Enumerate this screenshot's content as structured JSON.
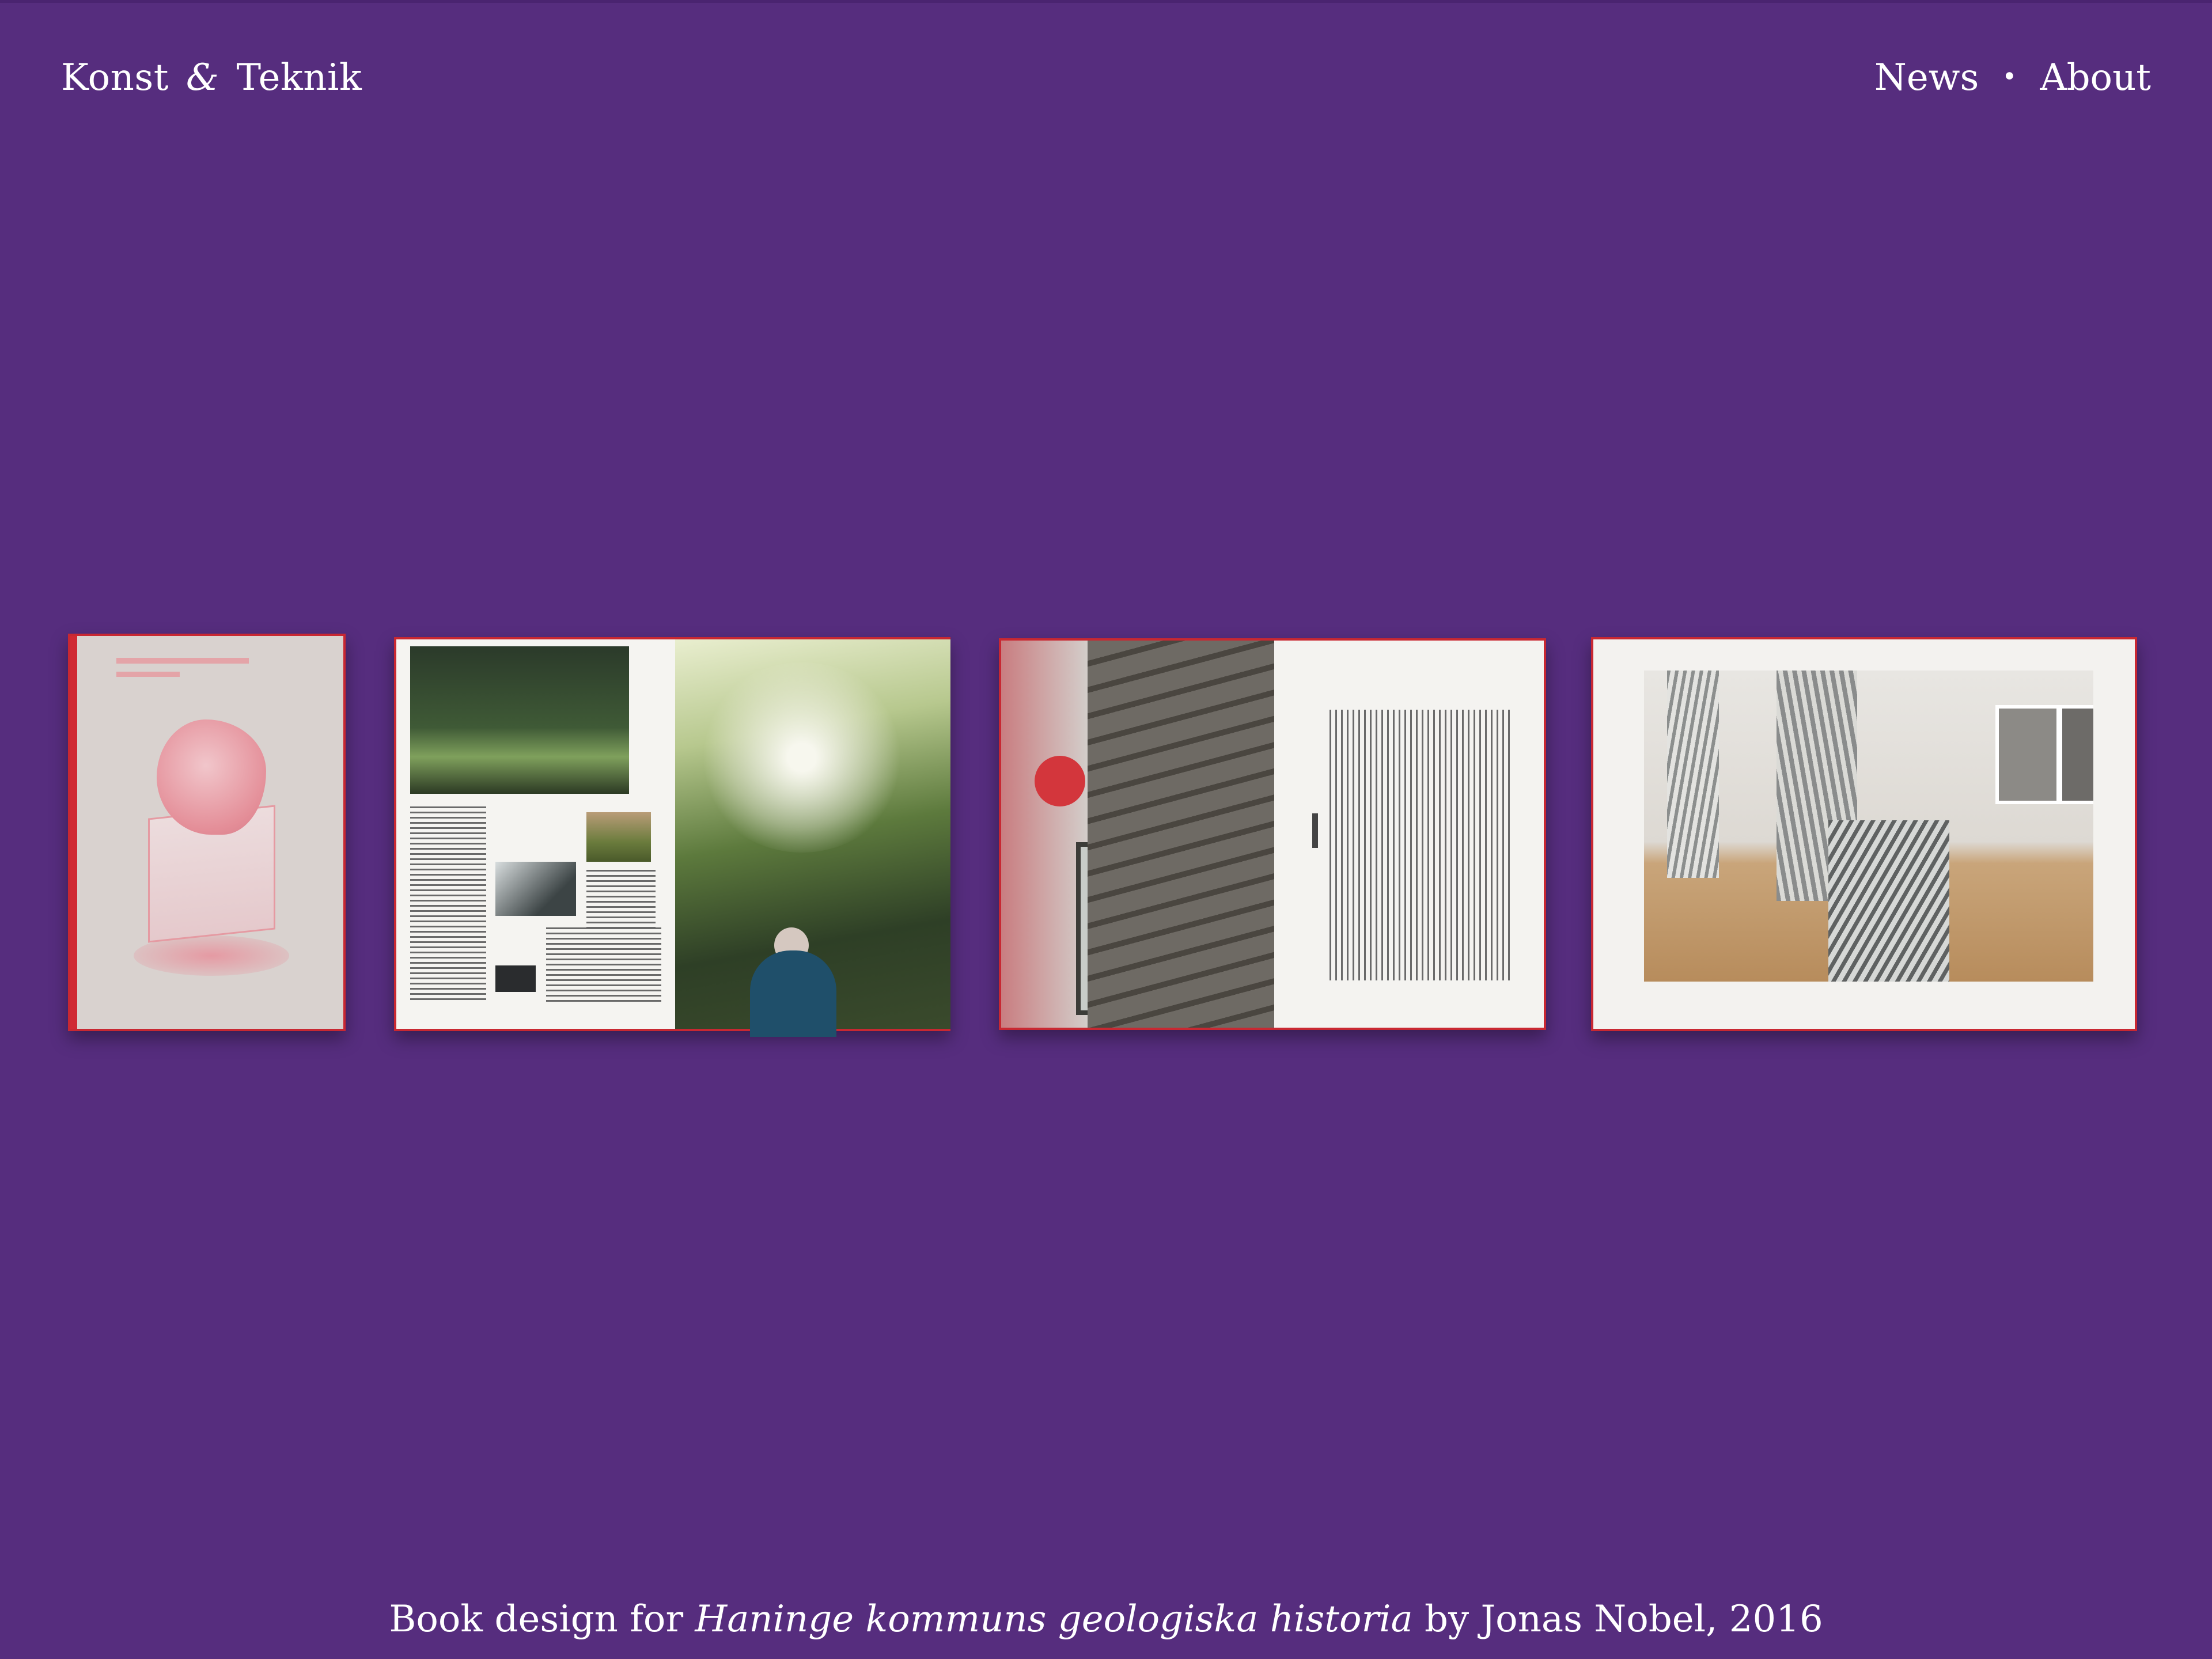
{
  "header": {
    "brand_left": "Konst",
    "brand_amp": "&",
    "brand_right": "Teknik",
    "nav": [
      "News",
      "About"
    ],
    "nav_separator": "•"
  },
  "gallery": {
    "slides": [
      {
        "kind": "cover"
      },
      {
        "kind": "spread-forest"
      },
      {
        "kind": "spread-text"
      },
      {
        "kind": "spread-sculpture"
      }
    ]
  },
  "caption": {
    "prefix": "Book design for ",
    "title": "Haninge kommuns geologiska historia",
    "suffix": " by Jonas Nobel, 2016"
  },
  "colors": {
    "background": "#562d7e",
    "book_edge": "#c82832",
    "text": "#ffffff"
  }
}
